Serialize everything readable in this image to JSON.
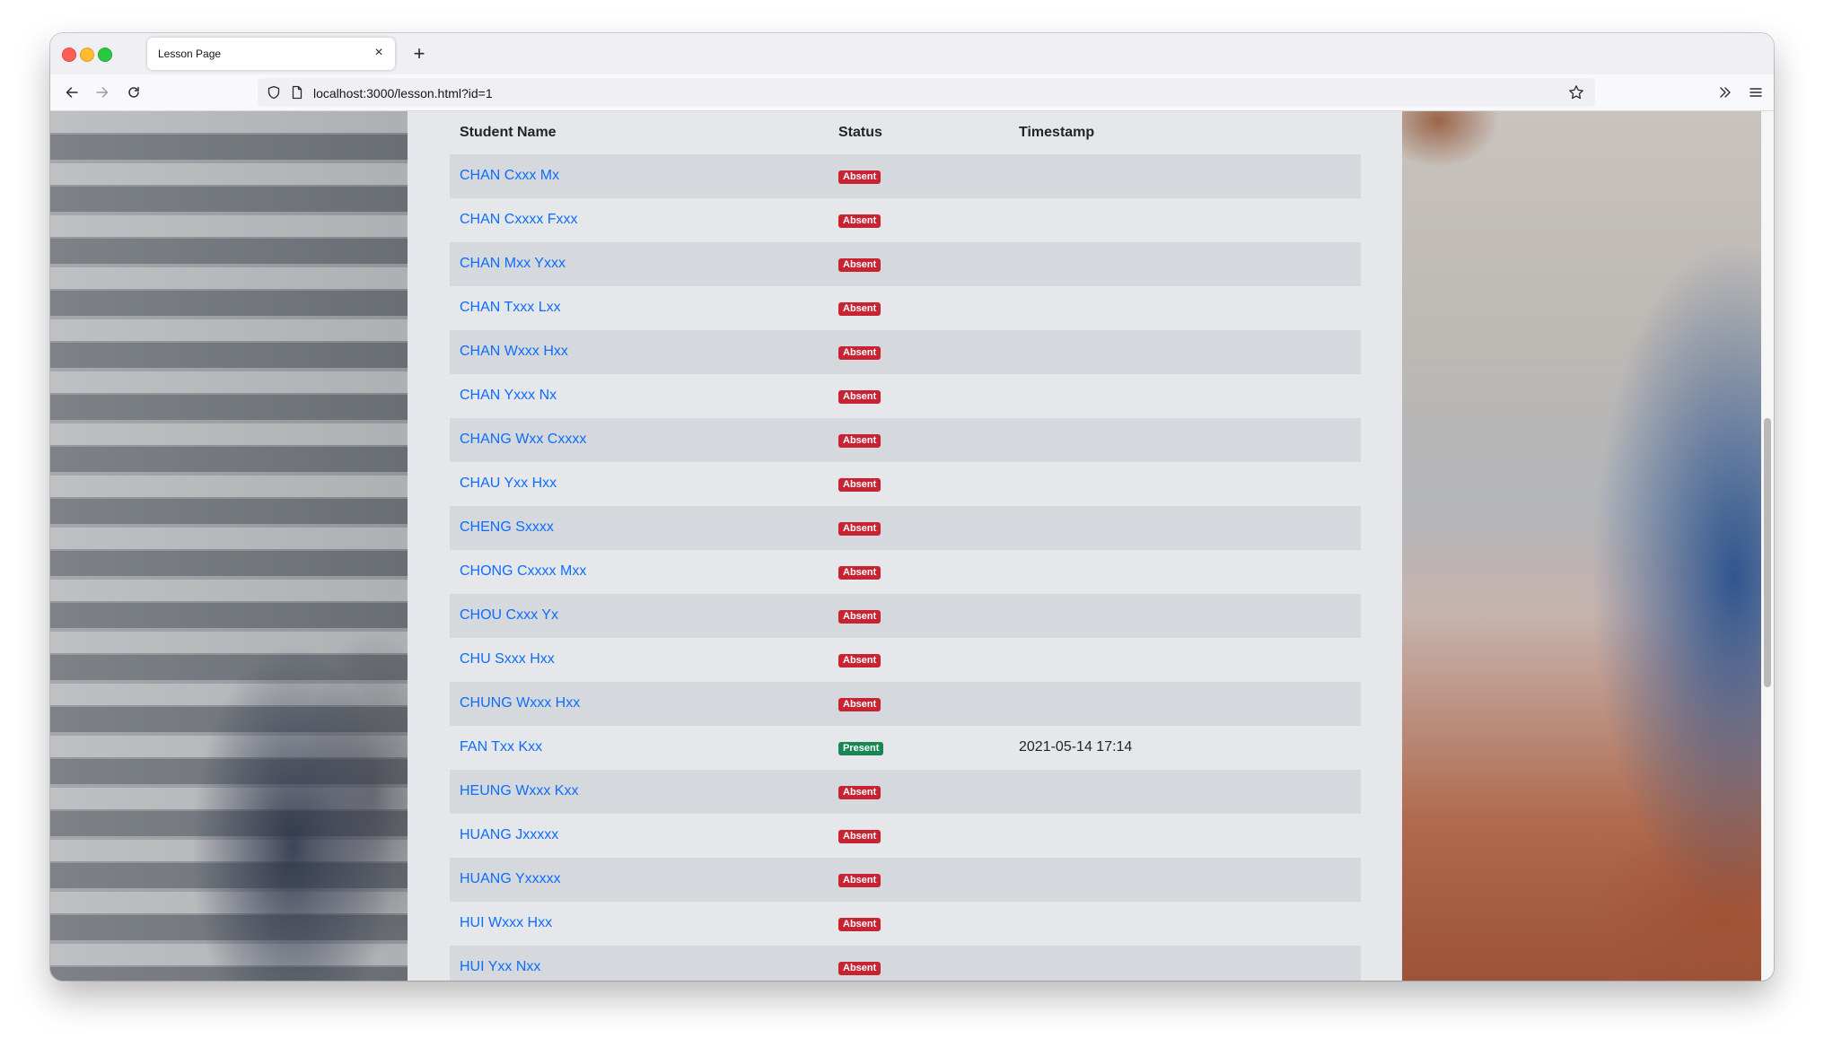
{
  "browser": {
    "tab_title": "Lesson Page",
    "tab_close": "×",
    "new_tab": "+",
    "url": "localhost:3000/lesson.html?id=1"
  },
  "table": {
    "headers": {
      "name": "Student Name",
      "status": "Status",
      "timestamp": "Timestamp"
    },
    "rows": [
      {
        "name": "CHAN Cxxx Mx",
        "status": "Absent",
        "timestamp": ""
      },
      {
        "name": "CHAN Cxxxx Fxxx",
        "status": "Absent",
        "timestamp": ""
      },
      {
        "name": "CHAN Mxx Yxxx",
        "status": "Absent",
        "timestamp": ""
      },
      {
        "name": "CHAN Txxx Lxx",
        "status": "Absent",
        "timestamp": ""
      },
      {
        "name": "CHAN Wxxx Hxx",
        "status": "Absent",
        "timestamp": ""
      },
      {
        "name": "CHAN Yxxx Nx",
        "status": "Absent",
        "timestamp": ""
      },
      {
        "name": "CHANG Wxx Cxxxx",
        "status": "Absent",
        "timestamp": ""
      },
      {
        "name": "CHAU Yxx Hxx",
        "status": "Absent",
        "timestamp": ""
      },
      {
        "name": "CHENG Sxxxx",
        "status": "Absent",
        "timestamp": ""
      },
      {
        "name": "CHONG Cxxxx Mxx",
        "status": "Absent",
        "timestamp": ""
      },
      {
        "name": "CHOU Cxxx Yx",
        "status": "Absent",
        "timestamp": ""
      },
      {
        "name": "CHU Sxxx Hxx",
        "status": "Absent",
        "timestamp": ""
      },
      {
        "name": "CHUNG Wxxx Hxx",
        "status": "Absent",
        "timestamp": ""
      },
      {
        "name": "FAN Txx Kxx",
        "status": "Present",
        "timestamp": "2021-05-14 17:14"
      },
      {
        "name": "HEUNG Wxxx Kxx",
        "status": "Absent",
        "timestamp": ""
      },
      {
        "name": "HUANG Jxxxxx",
        "status": "Absent",
        "timestamp": ""
      },
      {
        "name": "HUANG Yxxxxx",
        "status": "Absent",
        "timestamp": ""
      },
      {
        "name": "HUI Wxxx Hxx",
        "status": "Absent",
        "timestamp": ""
      },
      {
        "name": "HUI Yxx Nxx",
        "status": "Absent",
        "timestamp": ""
      }
    ]
  },
  "colors": {
    "link": "#0d6efd",
    "absent_badge": "#c82333",
    "present_badge": "#198754",
    "panel_background": "#e5e7ea",
    "striped_row": "#d5d8dc"
  },
  "icons": {
    "back": "arrow-left-icon",
    "forward": "arrow-right-icon",
    "reload": "reload-icon",
    "shield": "shield-icon",
    "page": "page-icon",
    "bookmark": "star-icon",
    "overflow": "chevrons-right-icon",
    "menu": "hamburger-menu-icon"
  }
}
